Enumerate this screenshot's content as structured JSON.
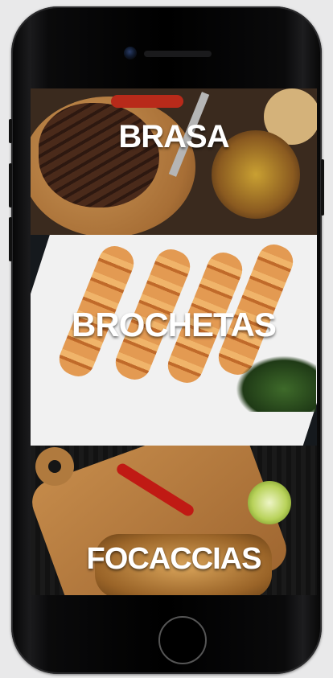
{
  "menu": {
    "items": [
      {
        "label": "BRASA"
      },
      {
        "label": "BROCHETAS"
      },
      {
        "label": "FOCACCIAS"
      }
    ]
  },
  "icons": {
    "front_camera": "camera-icon",
    "home_button": "home-button-icon"
  },
  "colors": {
    "label_text": "#ffffff",
    "phone_body": "#000000",
    "page_background": "#e9e9ea"
  }
}
